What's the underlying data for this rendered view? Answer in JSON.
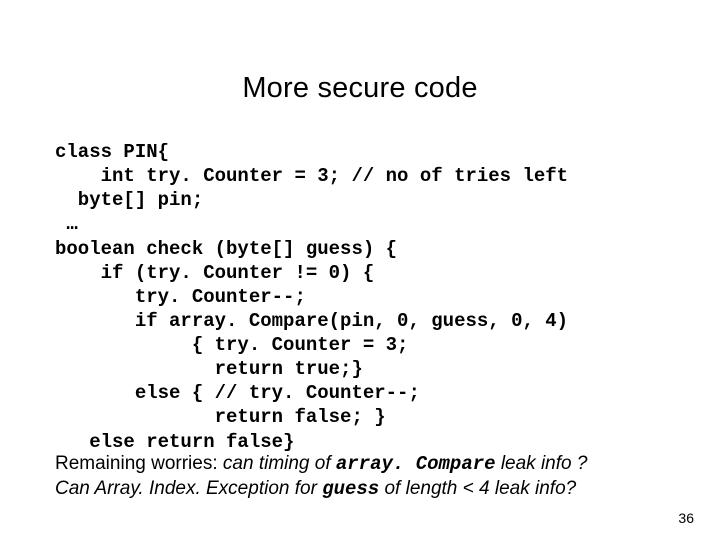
{
  "title": "More secure code",
  "code": {
    "l1": "class PIN{",
    "l2": "    int try. Counter = 3; // no of tries left",
    "l3": "  byte[] pin;",
    "l4": " …",
    "l5": "boolean check (byte[] guess) {",
    "l6": "    if (try. Counter != 0) {",
    "l7": "       try. Counter--;",
    "l8": "       if array. Compare(pin, 0, guess, 0, 4)",
    "l9": "            { try. Counter = 3;",
    "l10": "              return true;}",
    "l11": "       else { // try. Counter--;",
    "l12": "              return false; }",
    "l13": "   else return false}"
  },
  "worries": {
    "prefix": "Remaining worries: ",
    "line1_ital_a": "can timing of ",
    "line1_mono": "array. Compare",
    "line1_ital_b": "  leak info ?",
    "line2_a": "Can Array. Index. Exception for ",
    "line2_mono": "guess",
    "line2_b": " of length < 4 leak info?"
  },
  "page_number": "36"
}
